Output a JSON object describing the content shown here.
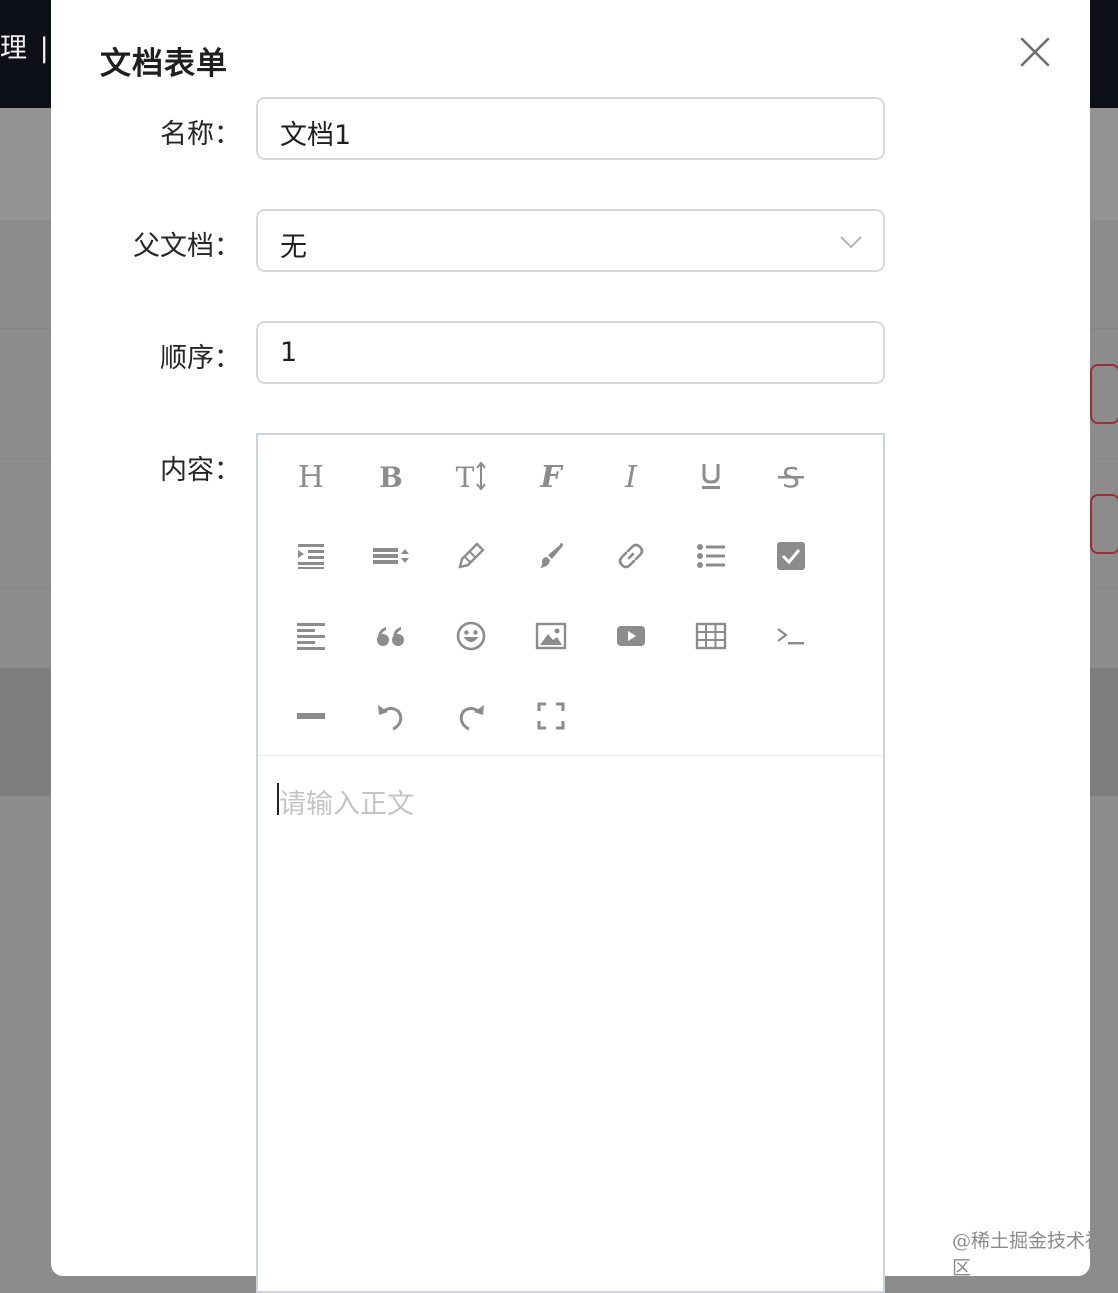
{
  "background": {
    "header_text": "理 |"
  },
  "modal": {
    "title": "文档表单",
    "close_icon": "close-icon",
    "fields": {
      "name": {
        "label": "名称：",
        "value": "文档1"
      },
      "parent": {
        "label": "父文档：",
        "value": "无"
      },
      "order": {
        "label": "顺序：",
        "value": "1"
      },
      "content": {
        "label": "内容：",
        "placeholder": "请输入正文"
      }
    },
    "toolbar": [
      [
        "heading-icon",
        "bold-icon",
        "font-size-icon",
        "font-family-icon",
        "italic-icon",
        "underline-icon",
        "strikethrough-icon"
      ],
      [
        "indent-icon",
        "line-height-icon",
        "font-color-icon",
        "background-color-icon",
        "link-icon",
        "bullet-list-icon",
        "todo-checkbox-icon"
      ],
      [
        "justify-icon",
        "quote-icon",
        "emoji-icon",
        "image-icon",
        "video-icon",
        "table-icon",
        "code-icon"
      ],
      [
        "divider-icon",
        "undo-icon",
        "redo-icon",
        "fullscreen-icon"
      ]
    ]
  },
  "watermark": "@稀土掘金技术社区",
  "colors": {
    "icon": "#8c8c8c",
    "overlay_header": "#0d1117",
    "danger_outline": "#9b2d34"
  }
}
